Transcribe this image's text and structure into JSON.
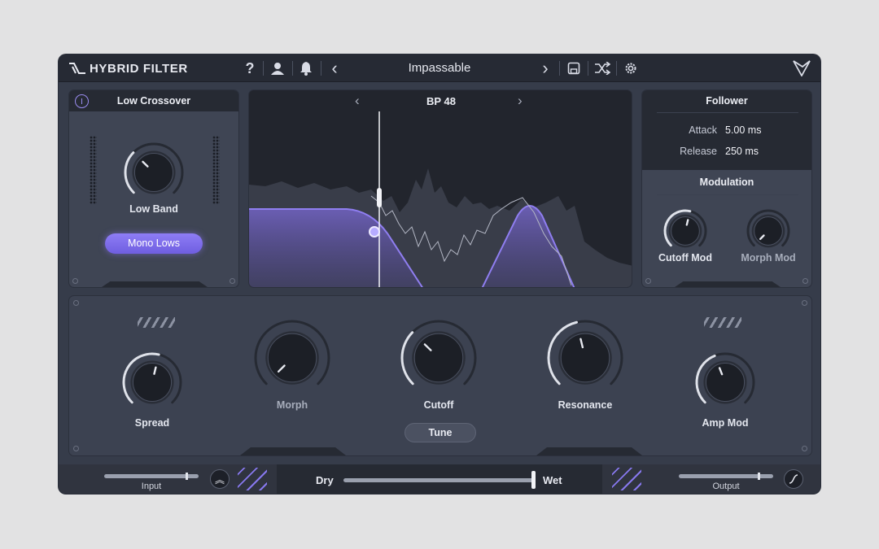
{
  "app": {
    "title": "HYBRID FILTER",
    "preset": "Impassable"
  },
  "header": {
    "icons": [
      "help-icon",
      "account-icon",
      "notification-bell-icon",
      "chevron-left-icon",
      "chevron-right-icon",
      "save-icon",
      "shuffle-icon",
      "gear-icon",
      "brand-logo-icon"
    ],
    "help_glyph": "?",
    "prev_glyph": "‹",
    "next_glyph": "›"
  },
  "low_crossover": {
    "title": "Low Crossover",
    "knob_label": "Low Band",
    "knob_level": 0.33,
    "mono_button": "Mono Lows"
  },
  "filter_display": {
    "type_label": "BP 48",
    "prev_glyph": "‹",
    "next_glyph": "›"
  },
  "follower": {
    "title": "Follower",
    "attack_label": "Attack",
    "attack_value": "5.00 ms",
    "release_label": "Release",
    "release_value": "250 ms"
  },
  "modulation": {
    "title": "Modulation",
    "knobs": [
      {
        "label": "Cutoff Mod",
        "level": 0.55
      },
      {
        "label": "Morph Mod",
        "level": 0.0
      }
    ]
  },
  "main": {
    "knobs": [
      {
        "label": "Spread",
        "level": 0.55
      },
      {
        "label": "Morph",
        "level": 0.0
      },
      {
        "label": "Cutoff",
        "level": 0.33
      },
      {
        "label": "Resonance",
        "level": 0.45
      },
      {
        "label": "Amp Mod",
        "level": 0.42
      }
    ],
    "tune_button": "Tune"
  },
  "footer": {
    "input_label": "Input",
    "input_level": 0.88,
    "output_label": "Output",
    "output_level": 0.85,
    "dry_label": "Dry",
    "wet_label": "Wet",
    "mix_level": 1.0,
    "expand_glyph": "︽"
  },
  "colors": {
    "accent": "#8e7df6",
    "panel": "#3f4554",
    "header": "#262a34"
  }
}
